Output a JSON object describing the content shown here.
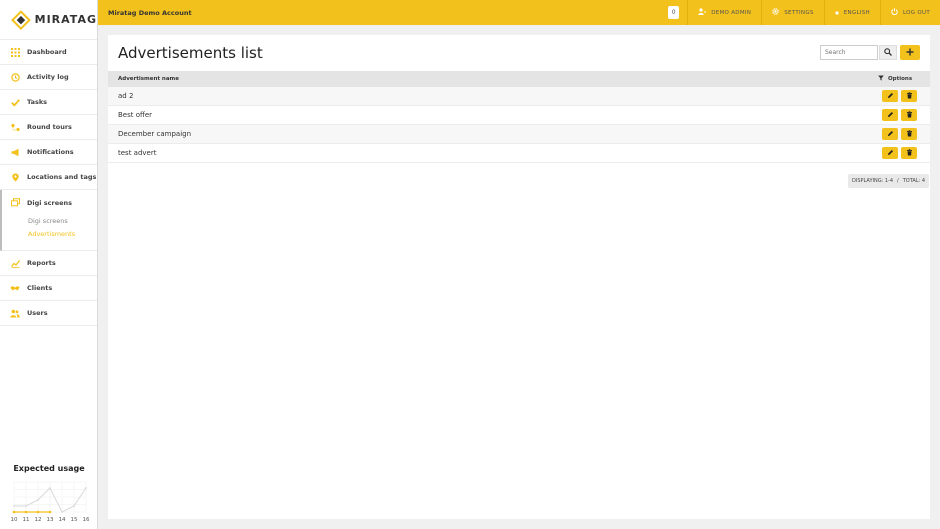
{
  "brand": {
    "name": "MIRATAG"
  },
  "topbar": {
    "account": "Miratag Demo Account",
    "badge": "0",
    "user": "DEMO ADMIN",
    "settings": "SETTINGS",
    "language": "ENGLISH",
    "logout": "LOG OUT"
  },
  "sidebar": {
    "items": [
      {
        "label": "Dashboard",
        "icon": "grid-icon"
      },
      {
        "label": "Activity log",
        "icon": "history-icon"
      },
      {
        "label": "Tasks",
        "icon": "check-icon"
      },
      {
        "label": "Round tours",
        "icon": "route-icon"
      },
      {
        "label": "Notifications",
        "icon": "megaphone-icon"
      },
      {
        "label": "Locations and tags",
        "icon": "pin-icon"
      },
      {
        "label": "Digi screens",
        "icon": "screens-icon",
        "sub": [
          "Digi screens",
          "Advertisments"
        ]
      },
      {
        "label": "Reports",
        "icon": "chart-icon"
      },
      {
        "label": "Clients",
        "icon": "handshake-icon"
      },
      {
        "label": "Users",
        "icon": "users-icon"
      }
    ]
  },
  "usage": {
    "title": "Expected usage",
    "chart_data": {
      "type": "line",
      "x": [
        10,
        11,
        12,
        13,
        14,
        15,
        16
      ],
      "series": [
        {
          "values": [
            1,
            1,
            2,
            4,
            0,
            1,
            4
          ]
        },
        {
          "values": [
            0,
            0,
            0,
            0,
            null,
            null,
            null
          ]
        }
      ],
      "tick_labels": [
        "10",
        "11",
        "12",
        "13",
        "14",
        "15",
        "16"
      ],
      "colors": [
        "#d9d9d9",
        "#f3c11b"
      ]
    }
  },
  "main": {
    "title": "Advertisements list",
    "search_placeholder": "Search",
    "columns": {
      "name": "Advertisment name",
      "options": "Options"
    },
    "rows": [
      "ad 2",
      "Best offer",
      "December campaign",
      "test advert"
    ],
    "pager": {
      "displaying": "DISPLAYING: 1-4",
      "separator": "/",
      "total": "TOTAL: 4"
    }
  },
  "colors": {
    "accent": "#f3c11b"
  }
}
